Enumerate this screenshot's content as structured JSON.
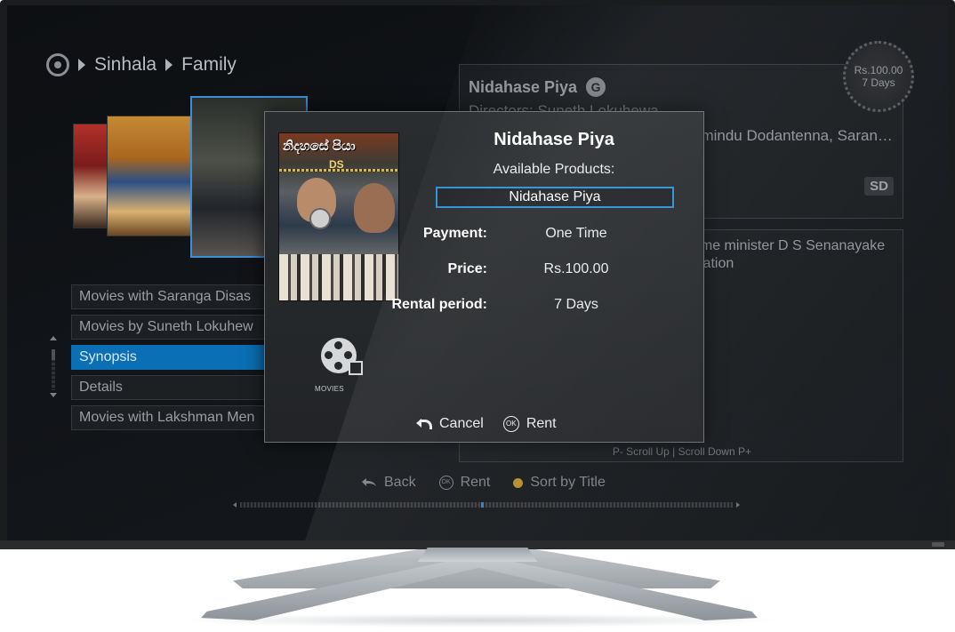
{
  "breadcrumb": {
    "items": [
      "Sinhala",
      "Family"
    ]
  },
  "left_list": {
    "items": [
      {
        "label": "Movies with Saranga Disas"
      },
      {
        "label": "Movies by Suneth Lokuhew"
      },
      {
        "label": "Synopsis",
        "selected": true
      },
      {
        "label": "Details"
      },
      {
        "label": "Movies with Lakshman Men"
      }
    ]
  },
  "info_panel": {
    "title": "Nidahase Piya",
    "rating": "G",
    "director_line": "Directors:   Suneth Lokuhewa",
    "cast_line": "umindu Dodantenna, Saran…",
    "quality": "SD",
    "price_badge": {
      "price": "Rs.100.00",
      "period": "7 Days"
    }
  },
  "synopsis_panel": {
    "text": "rime minister D S Senanayake Nation",
    "scroll_hint": "P- Scroll Up | Scroll Down P+"
  },
  "footer": {
    "back_label": "Back",
    "ok_glyph": "OK",
    "rent_label": "Rent",
    "sort_label": "Sort by Title",
    "sort_dot_color": "#b68b2a"
  },
  "modal": {
    "title": "Nidahase Piya",
    "available_label": "Available Products:",
    "product": "Nidahase Piya",
    "payment_label": "Payment:",
    "payment_value": "One Time",
    "price_label": "Price:",
    "price_value": "Rs.100.00",
    "rental_label": "Rental period:",
    "rental_value": "7 Days",
    "category_label": "MOVIES",
    "cover_title": "නිදහසේ පියා",
    "cover_subtitle": "DS",
    "cancel_label": "Cancel",
    "ok_glyph": "OK",
    "rent_label": "Rent"
  },
  "colors": {
    "accent": "#2b8fd8",
    "selected_row": "#0a6fb4"
  }
}
